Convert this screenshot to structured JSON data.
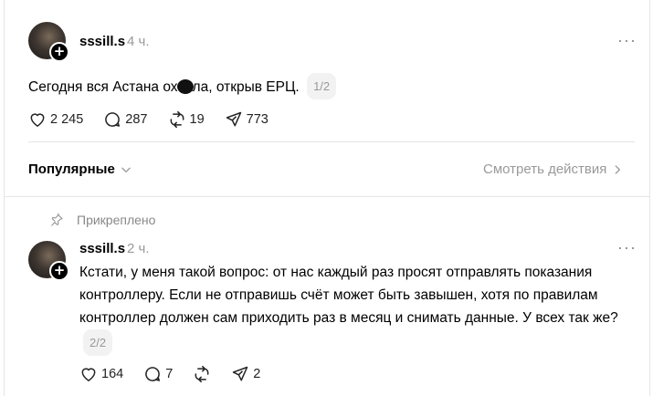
{
  "post": {
    "username": "sssill.s",
    "time": "4 ч.",
    "more_label": "···",
    "text_before": "Сегодня вся Астана ох",
    "text_after": "ла, открыв ЕРЦ.",
    "pager": "1/2",
    "likes": "2 245",
    "comments": "287",
    "reposts": "19",
    "shares": "773",
    "follow_icon": "plus-icon"
  },
  "comments_bar": {
    "sort_label": "Популярные",
    "view_activity_label": "Смотреть действия"
  },
  "reply": {
    "pinned_label": "Прикреплено",
    "username": "sssill.s",
    "time": "2 ч.",
    "more_label": "···",
    "text": "Кстати, у меня такой вопрос: от нас каждый раз просят отправлять показания контроллеру. Если не отправишь счёт может быть завышен, хотя по правилам контроллер должен сам приходить раз в месяц и снимать данные. У всех так же?",
    "pager": "2/2",
    "likes": "164",
    "comments": "7",
    "shares": "2",
    "follow_icon": "plus-icon"
  },
  "colors": {
    "muted": "#999999",
    "divider": "#e5e5e5",
    "text": "#000000"
  }
}
